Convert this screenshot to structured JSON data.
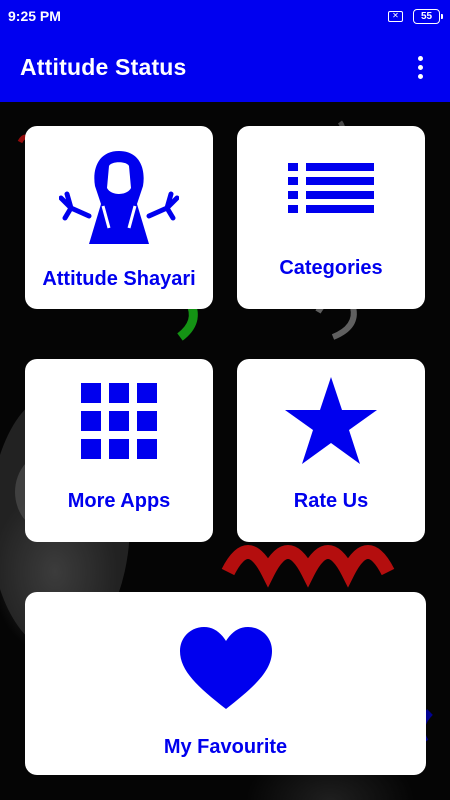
{
  "status_bar": {
    "time": "9:25 PM",
    "battery_level": "55"
  },
  "app_bar": {
    "title": "Attitude Status"
  },
  "menu": {
    "attitude_shayari": "Attitude Shayari",
    "categories": "Categories",
    "more_apps": "More Apps",
    "rate_us": "Rate Us",
    "my_favourite": "My Favourite"
  },
  "colors": {
    "primary": "#0000f0",
    "icon_blue": "#0000ee",
    "card_bg": "#ffffff",
    "background": "#000000"
  },
  "icons": {
    "attitude_shayari": "hooded-figure-icon",
    "categories": "list-icon",
    "more_apps": "grid-icon",
    "rate_us": "star-icon",
    "my_favourite": "heart-icon"
  }
}
